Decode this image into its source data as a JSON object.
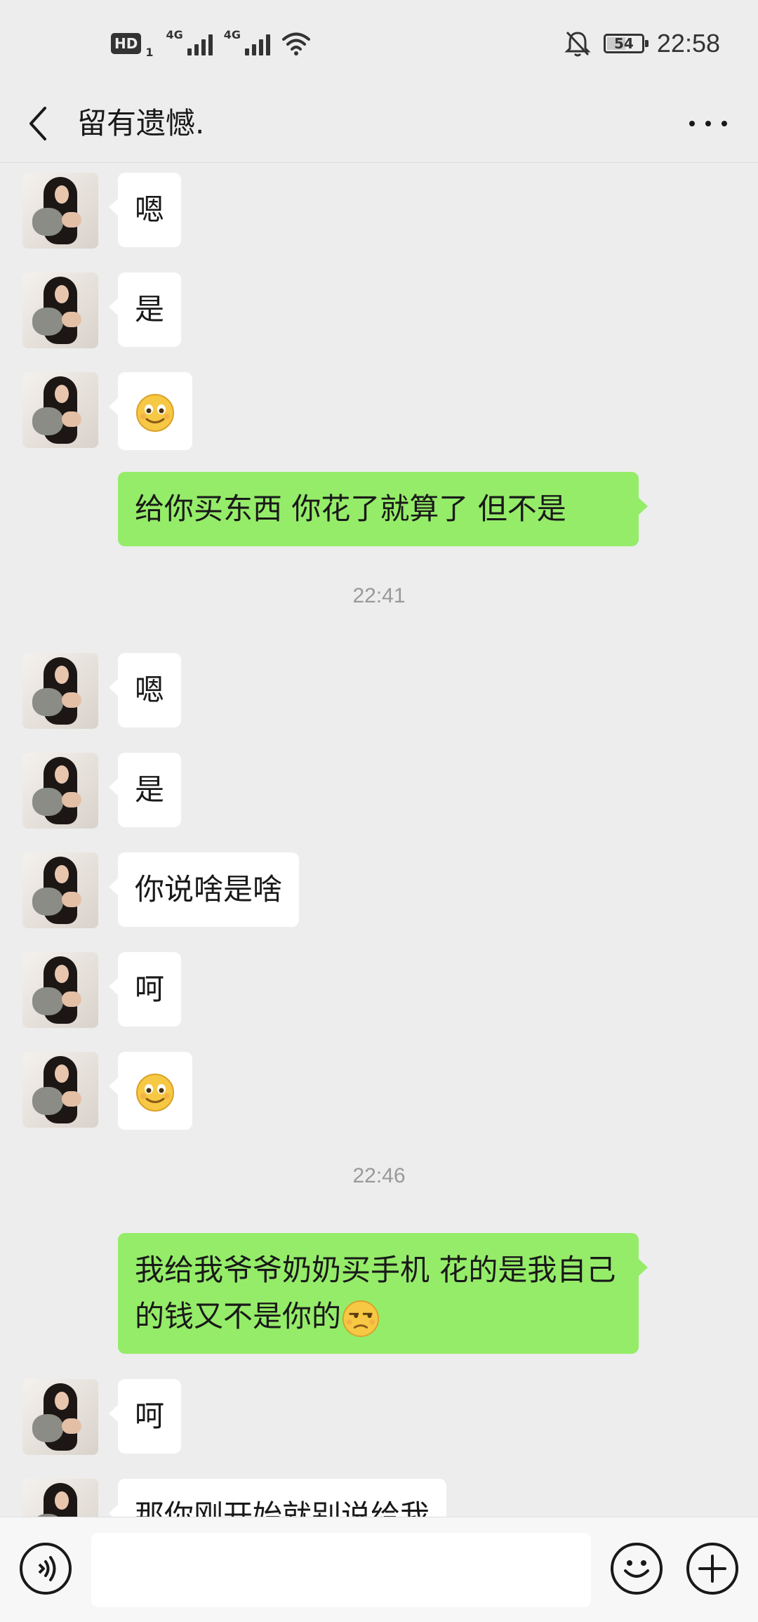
{
  "status_bar": {
    "hd_label": "HD",
    "hd_sub": "1",
    "network_1": "4G",
    "network_2": "4G",
    "battery": "54",
    "time": "22:58",
    "icons": [
      "hd-icon",
      "signal-icon",
      "signal-icon",
      "wifi-icon",
      "mute-bell-icon",
      "battery-icon"
    ]
  },
  "header": {
    "title": "留有遗憾.",
    "back_icon": "chevron-left-icon",
    "more_icon": "more-dots-icon"
  },
  "messages": [
    {
      "side": "left",
      "text": "嗯"
    },
    {
      "side": "left",
      "text": "是"
    },
    {
      "side": "left",
      "emoji": "smile-emoji"
    },
    {
      "side": "right",
      "text": "给你买东西 你花了就算了  但不是"
    },
    {
      "timestamp": "22:41"
    },
    {
      "side": "left",
      "text": "嗯"
    },
    {
      "side": "left",
      "text": "是"
    },
    {
      "side": "left",
      "text": "你说啥是啥"
    },
    {
      "side": "left",
      "text": "呵"
    },
    {
      "side": "left",
      "emoji": "smile-emoji"
    },
    {
      "timestamp": "22:46"
    },
    {
      "side": "right",
      "text": "我给我爷爷奶奶买手机 花的是我自己的钱又不是你的",
      "trailing_emoji": "unamused-emoji"
    },
    {
      "side": "left",
      "text": "呵"
    },
    {
      "side": "left",
      "text": "那你刚开始就别说给我"
    }
  ],
  "input_bar": {
    "voice_icon": "voice-icon",
    "emoji_icon": "emoji-icon",
    "plus_icon": "plus-icon",
    "value": ""
  },
  "colors": {
    "background": "#ededed",
    "sent_bubble": "#95ec69",
    "received_bubble": "#ffffff",
    "timestamp": "#999999"
  }
}
